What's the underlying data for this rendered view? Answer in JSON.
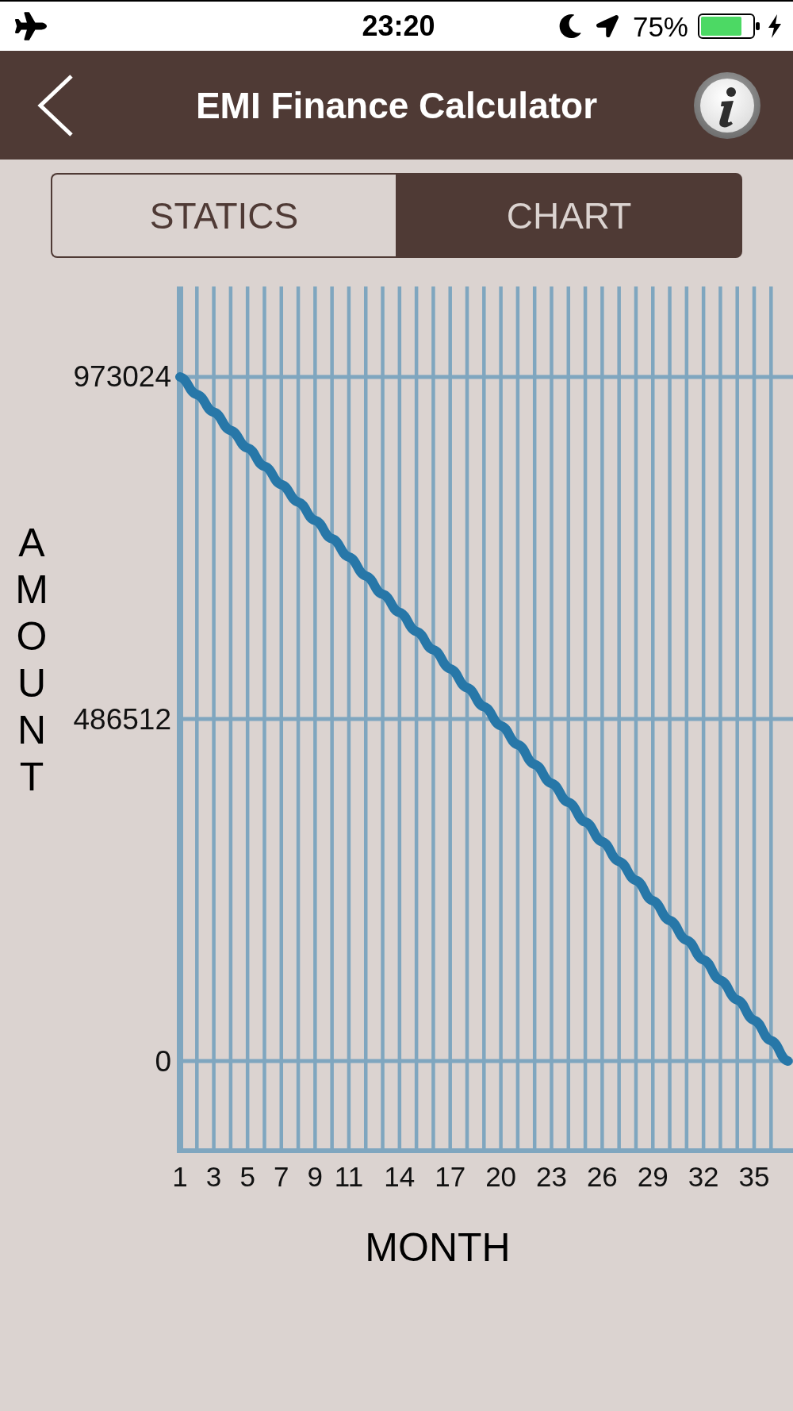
{
  "status_bar": {
    "time": "23:20",
    "battery": "75%"
  },
  "header": {
    "title": "EMI Finance Calculator"
  },
  "tabs": [
    {
      "label": "STATICS",
      "selected": false
    },
    {
      "label": "CHART",
      "selected": true
    }
  ],
  "chart": {
    "chart_data": {
      "type": "line",
      "xlabel": "MONTH",
      "ylabel": "AMOUNT",
      "x": [
        1,
        2,
        3,
        4,
        5,
        6,
        7,
        8,
        9,
        10,
        11,
        12,
        13,
        14,
        15,
        16,
        17,
        18,
        19,
        20,
        21,
        22,
        23,
        24,
        25,
        26,
        27,
        28,
        29,
        30,
        31,
        32,
        33,
        34,
        35,
        36,
        37
      ],
      "values": [
        973000,
        948000,
        923000,
        897000,
        872000,
        846000,
        820000,
        795000,
        769000,
        743000,
        717000,
        690000,
        664000,
        638000,
        611000,
        585000,
        558000,
        531000,
        504000,
        477000,
        450000,
        422000,
        395000,
        368000,
        340000,
        312000,
        284000,
        257000,
        228000,
        200000,
        172000,
        144000,
        115000,
        87000,
        58000,
        29000,
        0
      ],
      "xlim": [
        1,
        37.3
      ],
      "ylim": [
        -127500,
        1101700
      ],
      "xticks": [
        1,
        3,
        5,
        7,
        9,
        11,
        14,
        17,
        20,
        23,
        26,
        29,
        32,
        35
      ],
      "yticks": [
        0,
        486512,
        973024
      ],
      "grid": true
    }
  }
}
